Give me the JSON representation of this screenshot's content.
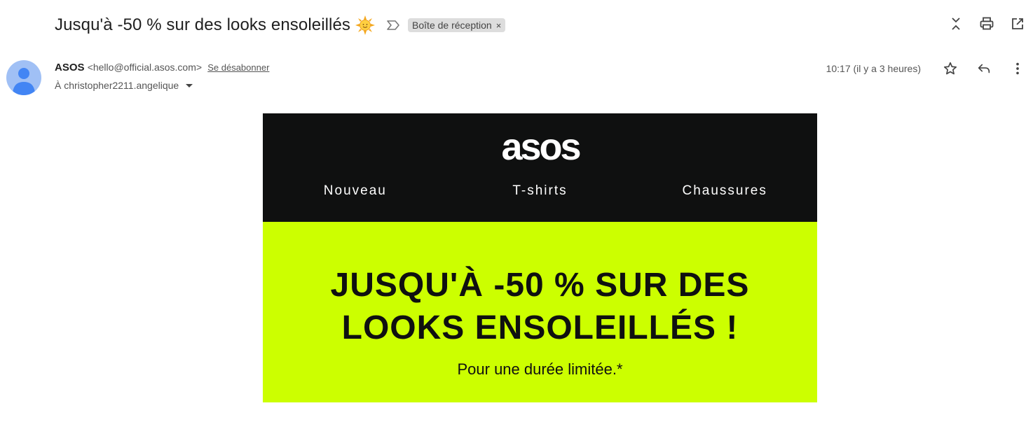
{
  "email": {
    "subject": "Jusqu'à -50 % sur des looks ensoleillés",
    "label": "Boîte de réception",
    "label_remove": "×",
    "sender_name": "ASOS",
    "sender_email": "<hello@official.asos.com>",
    "unsubscribe": "Se désabonner",
    "to": "À christopher2211.angelique",
    "time": "10:17 (il y a 3 heures)"
  },
  "icons": {
    "subject_emoji": "sun-icon",
    "important": "importance-marker-icon",
    "top_actions": [
      "collapse-icon",
      "print-icon",
      "open-in-new-window-icon"
    ],
    "row_actions": [
      "star-icon",
      "reply-icon",
      "more-vert-icon"
    ]
  },
  "content": {
    "logo": "asos",
    "nav": [
      "Nouveau",
      "T-shirts",
      "Chaussures"
    ],
    "promo_title_line1": "JUSQU'À -50 % SUR DES",
    "promo_title_line2": "LOOKS ENSOLEILLÉS !",
    "promo_subtitle": "Pour une durée limitée.*"
  },
  "colors": {
    "header_bg": "#0f1010",
    "promo_bg": "#ccff00",
    "avatar_bg": "#a0c0f5",
    "avatar_fg": "#4285f4"
  }
}
